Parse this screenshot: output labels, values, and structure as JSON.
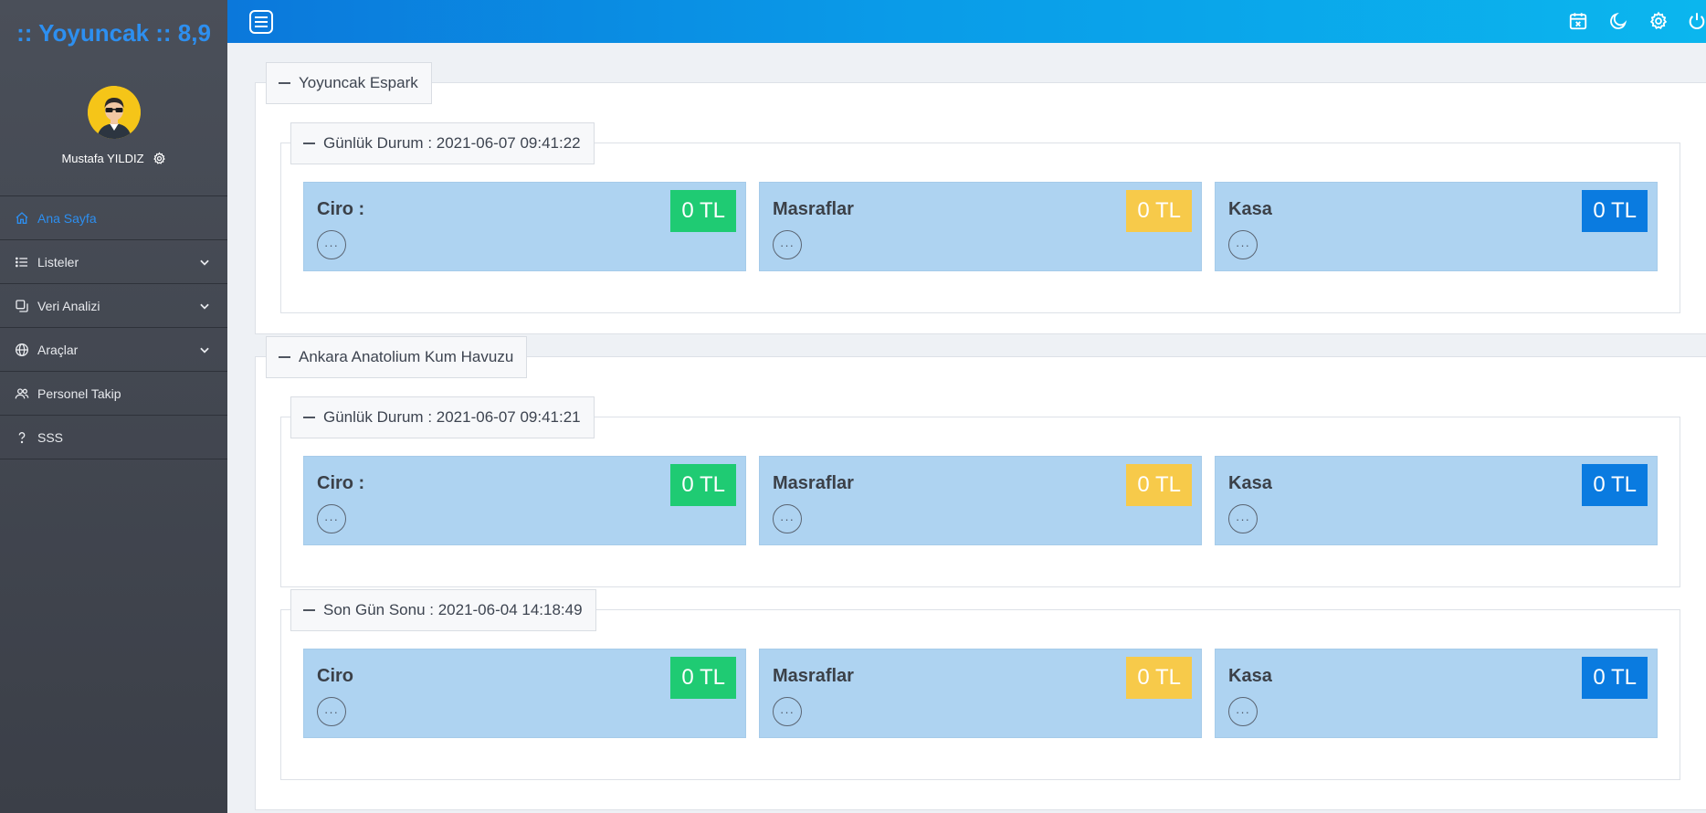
{
  "brand": ":: Yoyuncak :: 8,9",
  "user": {
    "name": "Mustafa YILDIZ"
  },
  "nav": [
    {
      "label": "Ana Sayfa",
      "icon": "home-icon",
      "active": true
    },
    {
      "label": "Listeler",
      "icon": "list-icon",
      "dropdown": true
    },
    {
      "label": "Veri Analizi",
      "icon": "copy-icon",
      "dropdown": true
    },
    {
      "label": "Araçlar",
      "icon": "globe-icon",
      "dropdown": true
    },
    {
      "label": "Personel Takip",
      "icon": "users-icon"
    },
    {
      "label": "SSS",
      "icon": "question-icon"
    }
  ],
  "topbar": {
    "icons": [
      "calendar-icon",
      "moon-icon",
      "settings-icon",
      "power-icon"
    ]
  },
  "sections": [
    {
      "title": "Yoyuncak Espark",
      "groups": [
        {
          "title": "Günlük Durum : 2021-06-07 09:41:22",
          "cards": [
            {
              "title": "Ciro :",
              "value": "0 TL",
              "color": "#1fcb73"
            },
            {
              "title": "Masraflar",
              "value": "0 TL",
              "color": "#f7ca4a"
            },
            {
              "title": "Kasa",
              "value": "0 TL",
              "color": "#0a7be0"
            }
          ]
        }
      ]
    },
    {
      "title": "Ankara Anatolium Kum Havuzu",
      "groups": [
        {
          "title": "Günlük Durum : 2021-06-07 09:41:21",
          "cards": [
            {
              "title": "Ciro :",
              "value": "0 TL",
              "color": "#1fcb73"
            },
            {
              "title": "Masraflar",
              "value": "0 TL",
              "color": "#f7ca4a"
            },
            {
              "title": "Kasa",
              "value": "0 TL",
              "color": "#0a7be0"
            }
          ]
        },
        {
          "title": "Son Gün Sonu : 2021-06-04 14:18:49",
          "cards": [
            {
              "title": "Ciro",
              "value": "0 TL",
              "color": "#1fcb73"
            },
            {
              "title": "Masraflar",
              "value": "0 TL",
              "color": "#f7ca4a"
            },
            {
              "title": "Kasa",
              "value": "0 TL",
              "color": "#0a7be0"
            }
          ]
        }
      ]
    }
  ],
  "more_symbol": "···"
}
